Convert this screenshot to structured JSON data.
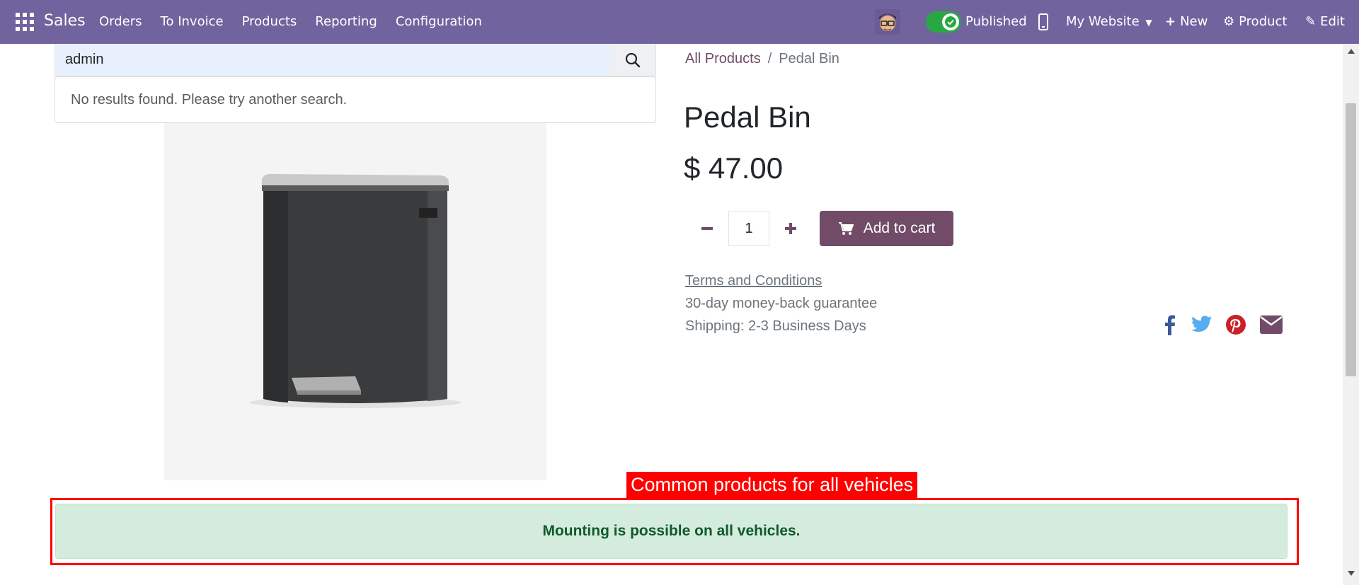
{
  "navbar": {
    "app_name": "Sales",
    "menu": [
      "Orders",
      "To Invoice",
      "Products",
      "Reporting",
      "Configuration"
    ],
    "published_label": "Published",
    "website_label": "My Website",
    "new_label": "New",
    "product_label": "Product",
    "edit_label": "Edit",
    "color": "#71639e"
  },
  "search": {
    "value": "admin",
    "no_results": "No results found. Please try another search."
  },
  "breadcrumb": {
    "parent": "All Products",
    "current": "Pedal Bin"
  },
  "product": {
    "title": "Pedal Bin",
    "price": "$ 47.00",
    "quantity": "1",
    "add_to_cart_label": "Add to cart",
    "terms_label": "Terms and Conditions",
    "guarantee": "30-day money-back guarantee",
    "shipping": "Shipping: 2-3 Business Days"
  },
  "social": [
    "facebook-icon",
    "twitter-icon",
    "pinterest-icon",
    "email-icon"
  ],
  "annotation": {
    "label": "Common products for all vehicles",
    "color": "#ff0000"
  },
  "alert": {
    "message": "Mounting is possible on all vehicles.",
    "color": "#d4ecdd"
  },
  "accent_color": "#714b67"
}
